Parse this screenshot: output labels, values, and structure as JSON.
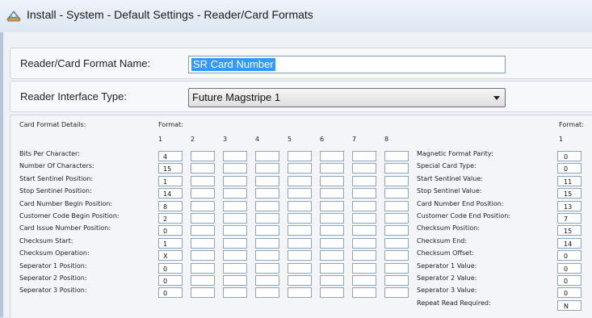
{
  "window": {
    "title": "Install - System - Default Settings - Reader/Card Formats"
  },
  "format_name": {
    "label": "Reader/Card Format Name:",
    "value": "SR Card Number"
  },
  "reader_interface": {
    "label": "Reader Interface Type:",
    "value": "Future Magstripe 1"
  },
  "details": {
    "header": "Card Format Details:",
    "format_label": "Format:",
    "columns": [
      "1",
      "2",
      "3",
      "4",
      "5",
      "6",
      "7",
      "8"
    ],
    "right_format_label": "Format:",
    "right_column": "1",
    "left_rows": [
      {
        "label": "Bits Per Character:",
        "value": "4"
      },
      {
        "label": "Number Of Characters:",
        "value": "15"
      },
      {
        "label": "Start Sentinel Position:",
        "value": "1"
      },
      {
        "label": "Stop Sentinel Position:",
        "value": "14"
      },
      {
        "label": "Card Number Begin Position:",
        "value": "8"
      },
      {
        "label": "Customer Code Begin Position:",
        "value": "2"
      },
      {
        "label": "Card Issue Number Position:",
        "value": "0"
      },
      {
        "label": "Checksum Start:",
        "value": "1"
      },
      {
        "label": "Checksum Operation:",
        "value": "X"
      },
      {
        "label": "Seperator 1 Position:",
        "value": "0"
      },
      {
        "label": "Seperator 2 Position:",
        "value": "0"
      },
      {
        "label": "Seperator 3 Position:",
        "value": "0"
      }
    ],
    "right_rows": [
      {
        "label": "Magnetic Format Parity:",
        "value": "0"
      },
      {
        "label": "Special Card Type:",
        "value": "0"
      },
      {
        "label": "Start Sentinel Value:",
        "value": "11"
      },
      {
        "label": "Stop Sentinel Value:",
        "value": "15"
      },
      {
        "label": "Card Number End Position:",
        "value": "13"
      },
      {
        "label": "Customer Code End Position:",
        "value": "7"
      },
      {
        "label": "Checksum Position:",
        "value": "15"
      },
      {
        "label": "Checksum End:",
        "value": "14"
      },
      {
        "label": "Checksum Offset:",
        "value": "0"
      },
      {
        "label": "Seperator 1 Value:",
        "value": "0"
      },
      {
        "label": "Seperator 2 Value:",
        "value": "0"
      },
      {
        "label": "Seperator 3 Value:",
        "value": "0"
      },
      {
        "label": "Repeat Read Required:",
        "value": "N"
      }
    ]
  }
}
